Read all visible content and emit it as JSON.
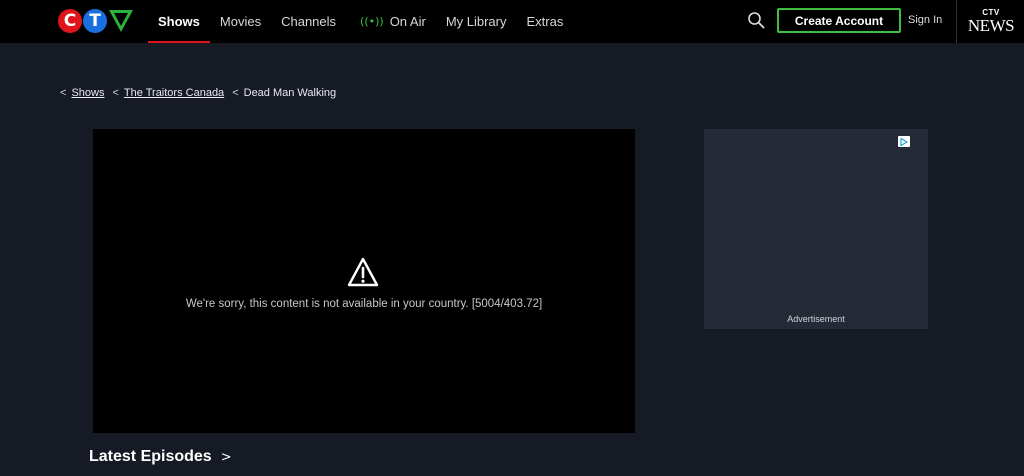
{
  "header": {
    "logo": {
      "c": "C",
      "t": "T",
      "v": "V"
    },
    "nav": [
      {
        "label": "Shows",
        "active": true
      },
      {
        "label": "Movies"
      },
      {
        "label": "Channels"
      },
      {
        "label": "On Air",
        "icon": "broadcast-icon"
      },
      {
        "label": "My Library"
      },
      {
        "label": "Extras"
      }
    ],
    "onair_icon": "((•))",
    "create_account": "Create Account",
    "sign_in": "Sign In",
    "news_logo": {
      "ctv": "CTV",
      "news": "NEWS"
    }
  },
  "breadcrumb": {
    "sep": "<",
    "items": [
      {
        "label": "Shows"
      },
      {
        "label": "The Traitors Canada"
      }
    ],
    "current": "Dead Man Walking"
  },
  "player": {
    "message": "We're sorry, this content is not available in your country. [5004/403.72]"
  },
  "ad": {
    "label": "Advertisement"
  },
  "latest": {
    "title": "Latest Episodes",
    "chevron": ">"
  },
  "colors": {
    "background": "#151a25",
    "header": "#000000",
    "accent_red": "#e1141b",
    "accent_green": "#3fbf3f",
    "ctv_blue": "#1a6fe0"
  }
}
